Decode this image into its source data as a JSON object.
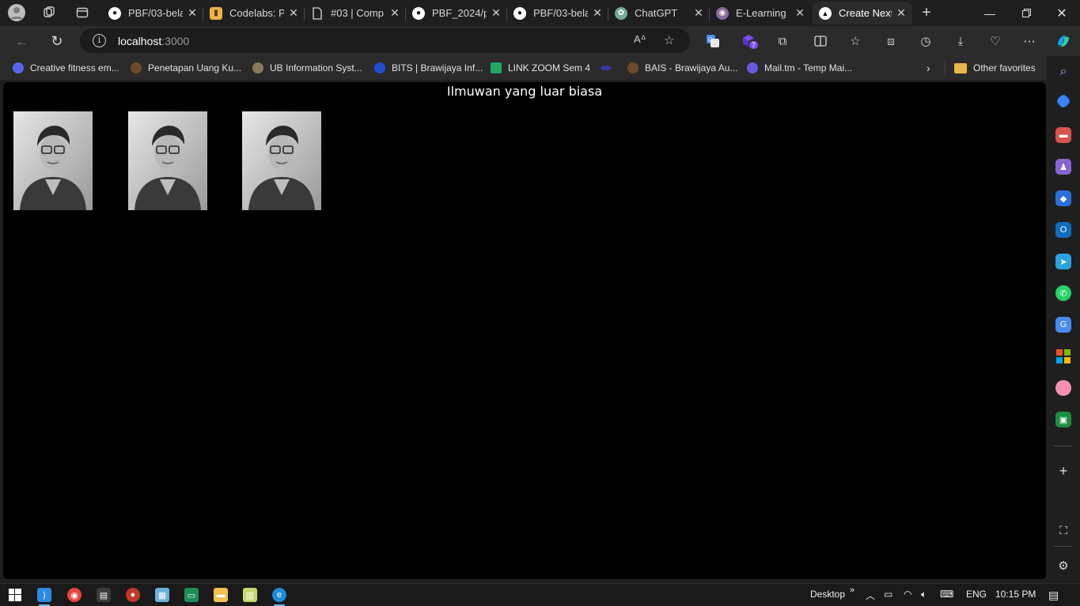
{
  "browser": {
    "tabs": [
      {
        "title": "PBF/03-bela",
        "icon": "github-icon"
      },
      {
        "title": "Codelabs: P",
        "icon": "codelabs-icon"
      },
      {
        "title": "#03 | Comp",
        "icon": "document-icon"
      },
      {
        "title": "PBF_2024/p",
        "icon": "github-icon"
      },
      {
        "title": "PBF/03-bela",
        "icon": "github-icon"
      },
      {
        "title": "ChatGPT",
        "icon": "chatgpt-icon"
      },
      {
        "title": "E-Learning",
        "icon": "elearning-icon"
      },
      {
        "title": "Create Next",
        "icon": "nextjs-icon",
        "active": true
      }
    ],
    "address": {
      "host": "localhost",
      "port": ":3000"
    },
    "favorites": [
      {
        "label": "Creative fitness em...",
        "icon": "discord-icon",
        "color": "#5865f2"
      },
      {
        "label": "Penetapan Uang Ku...",
        "icon": "ub-logo-icon",
        "color": "#6b4b2a"
      },
      {
        "label": "UB Information Syst...",
        "icon": "ub-logo-icon",
        "color": "#8a7a5a"
      },
      {
        "label": "BITS | Brawijaya Inf...",
        "icon": "bits-icon",
        "color": "#1e4fd6"
      },
      {
        "label": "LINK ZOOM Sem 4",
        "icon": "sheets-icon",
        "color": "#23a566"
      },
      {
        "label": "",
        "icon": "link-icon",
        "color": "#3a3aa0"
      },
      {
        "label": "BAIS - Brawijaya Au...",
        "icon": "ub-logo-icon",
        "color": "#6b4b2a"
      },
      {
        "label": "Mail.tm - Temp Mai...",
        "icon": "mail-icon",
        "color": "#6a5ae0"
      }
    ],
    "other_favorites": "Other favorites",
    "extension_badge": "7"
  },
  "page": {
    "heading": "Ilmuwan yang luar biasa",
    "images": [
      {
        "alt": "scientist-portrait"
      },
      {
        "alt": "scientist-portrait"
      },
      {
        "alt": "scientist-portrait"
      }
    ]
  },
  "taskbar": {
    "desktop_label": "Desktop",
    "language": "ENG",
    "time": "10:15 PM"
  },
  "colors": {
    "page_background": "#000000",
    "accent": "#6cb8f6"
  }
}
